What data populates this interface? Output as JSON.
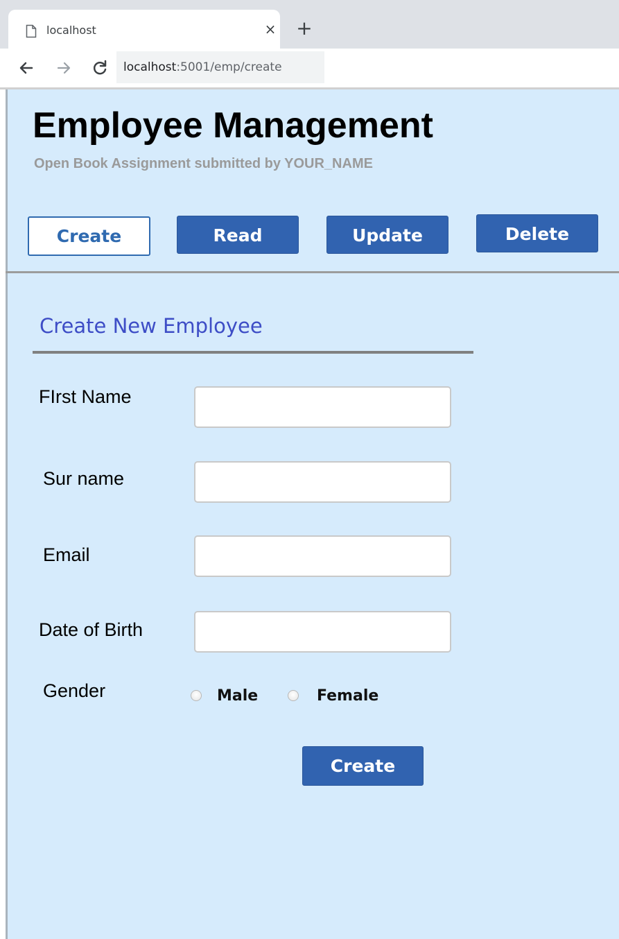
{
  "browser": {
    "tab_title": "localhost",
    "url_host": "localhost",
    "url_path": ":5001/emp/create",
    "close_glyph": "×",
    "new_tab_glyph": "+"
  },
  "header": {
    "title": "Employee Management",
    "subtitle": "Open Book Assignment submitted by YOUR_NAME"
  },
  "nav": {
    "tabs": [
      {
        "label": "Create",
        "active": true
      },
      {
        "label": "Read",
        "active": false
      },
      {
        "label": "Update",
        "active": false
      },
      {
        "label": "Delete",
        "active": false
      }
    ]
  },
  "form": {
    "title": "Create New Employee",
    "first_name": {
      "label": "FIrst Name",
      "value": ""
    },
    "surname": {
      "label": "Sur name",
      "value": ""
    },
    "email": {
      "label": "Email",
      "value": ""
    },
    "dob": {
      "label": "Date of Birth",
      "value": ""
    },
    "gender": {
      "label": "Gender",
      "options": [
        "Male",
        "Female"
      ],
      "selected": null
    },
    "submit_label": "Create"
  },
  "colors": {
    "page_bg": "#d6ebfc",
    "button_blue": "#3163b0",
    "section_title": "#3d4dc6",
    "subtitle_gray": "#9a9a9a"
  }
}
